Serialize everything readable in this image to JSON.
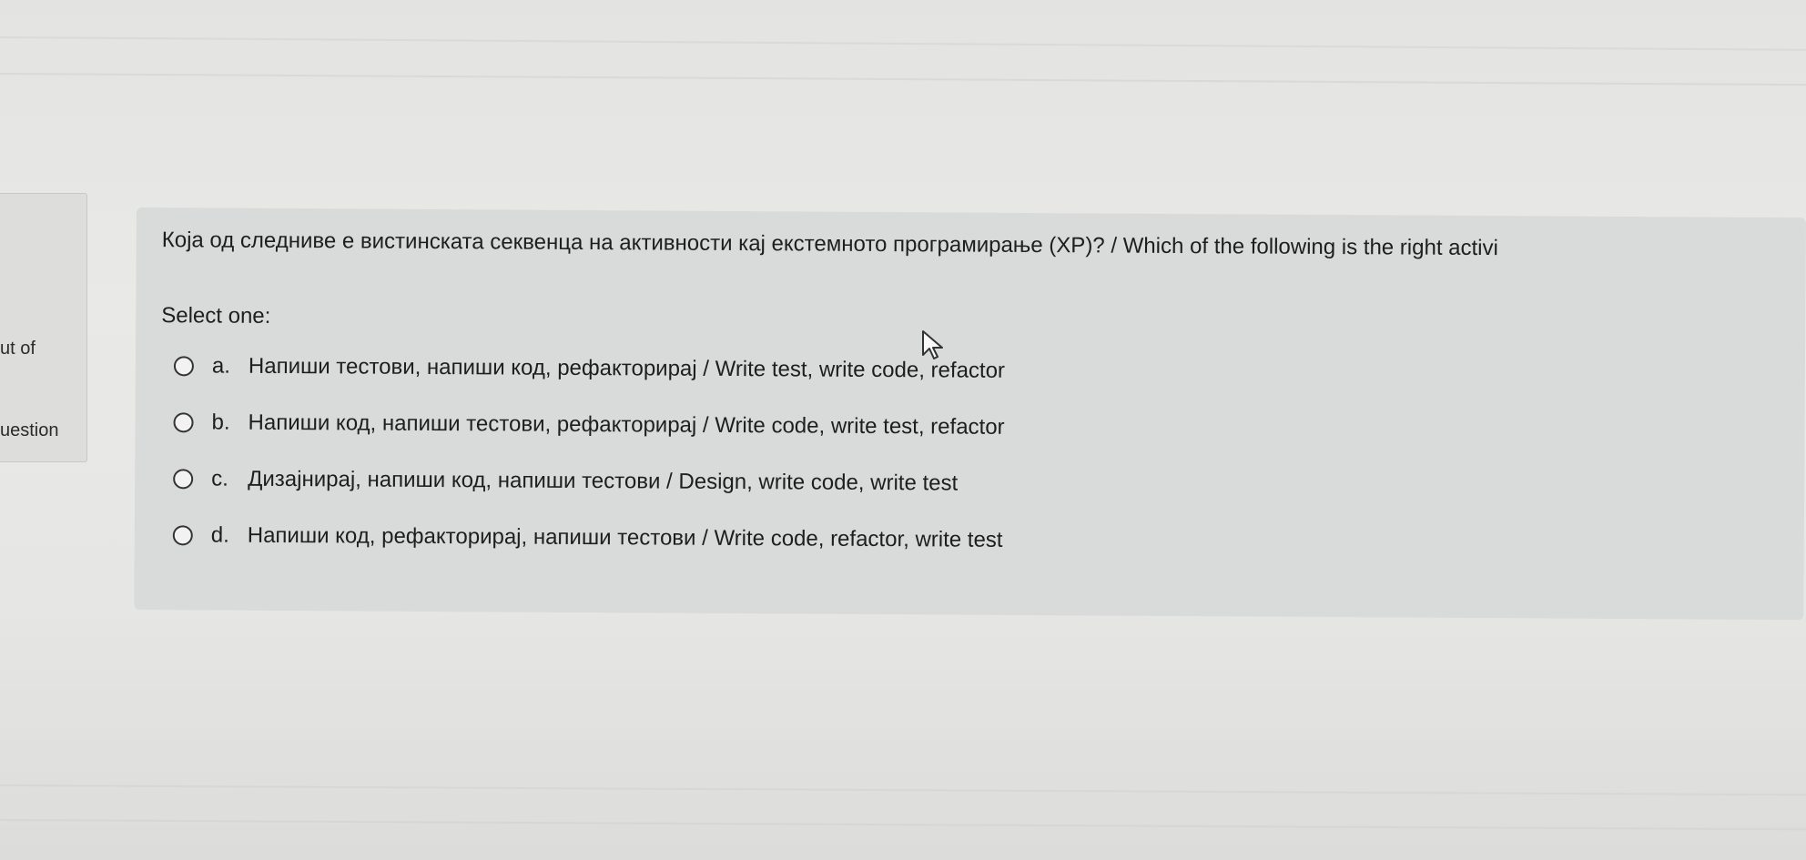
{
  "sidebar": {
    "number_fragment": "",
    "out_of_fragment": "ut of",
    "question_fragment": "uestion"
  },
  "question": {
    "text": "Која од следниве е вистинската секвенца на активности кај екстемното програмирање (XP)? / Which of the following is the right activi",
    "prompt": "Select one:",
    "answers": [
      {
        "letter": "a.",
        "text": "Напиши тестови, напиши код, рефакторирај / Write test, write code, refactor"
      },
      {
        "letter": "b.",
        "text": "Напиши код, напиши тестови, рефакторирај / Write code, write test, refactor"
      },
      {
        "letter": "c.",
        "text": "Дизајнирај, напиши код, напиши тестови / Design, write code, write test"
      },
      {
        "letter": "d.",
        "text": "Напиши код, рефакторирај, напиши тестови / Write code, refactor, write test"
      }
    ]
  },
  "icons": {
    "cursor": "arrow-cursor-icon",
    "radio": "radio-unchecked-icon"
  },
  "colors": {
    "question_background": "#d9dbda",
    "page_background": "#e6e6e4"
  }
}
